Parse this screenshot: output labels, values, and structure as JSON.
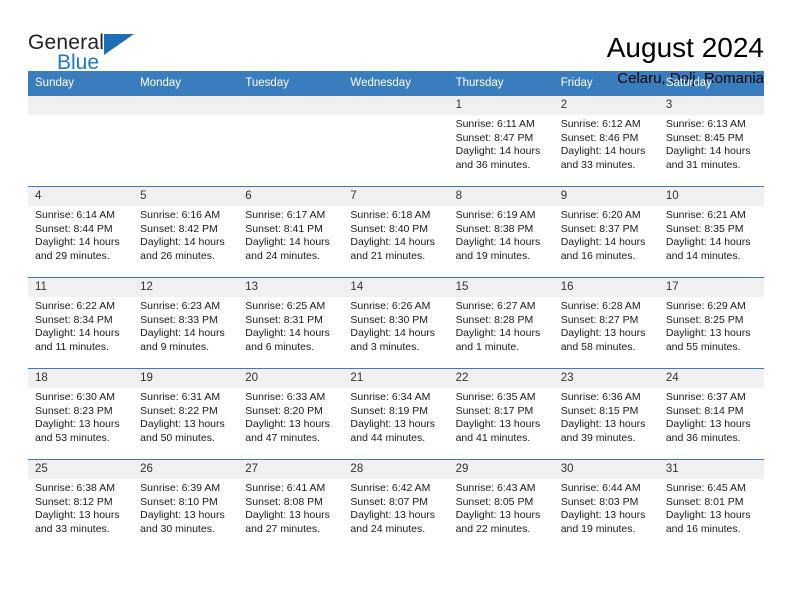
{
  "brand": {
    "name_top": "General",
    "name_bottom": "Blue",
    "accent_color": "#1f6fb5",
    "triangle_icon": "brand-triangle-icon"
  },
  "header": {
    "title": "August 2024",
    "subtitle": "Celaru, Dolj, Romania"
  },
  "calendar": {
    "header_bg": "#3a7dbf",
    "daynum_bg": "#f0f0f0",
    "weekday_headers": [
      "Sunday",
      "Monday",
      "Tuesday",
      "Wednesday",
      "Thursday",
      "Friday",
      "Saturday"
    ],
    "labels": {
      "sunrise": "Sunrise:",
      "sunset": "Sunset:",
      "daylight": "Daylight:"
    },
    "weeks": [
      [
        {
          "day": "",
          "blank": true
        },
        {
          "day": "",
          "blank": true
        },
        {
          "day": "",
          "blank": true
        },
        {
          "day": "",
          "blank": true
        },
        {
          "day": "1",
          "sunrise": "Sunrise: 6:11 AM",
          "sunset": "Sunset: 8:47 PM",
          "daylight_line1": "Daylight: 14 hours",
          "daylight_line2": "and 36 minutes."
        },
        {
          "day": "2",
          "sunrise": "Sunrise: 6:12 AM",
          "sunset": "Sunset: 8:46 PM",
          "daylight_line1": "Daylight: 14 hours",
          "daylight_line2": "and 33 minutes."
        },
        {
          "day": "3",
          "sunrise": "Sunrise: 6:13 AM",
          "sunset": "Sunset: 8:45 PM",
          "daylight_line1": "Daylight: 14 hours",
          "daylight_line2": "and 31 minutes."
        }
      ],
      [
        {
          "day": "4",
          "sunrise": "Sunrise: 6:14 AM",
          "sunset": "Sunset: 8:44 PM",
          "daylight_line1": "Daylight: 14 hours",
          "daylight_line2": "and 29 minutes."
        },
        {
          "day": "5",
          "sunrise": "Sunrise: 6:16 AM",
          "sunset": "Sunset: 8:42 PM",
          "daylight_line1": "Daylight: 14 hours",
          "daylight_line2": "and 26 minutes."
        },
        {
          "day": "6",
          "sunrise": "Sunrise: 6:17 AM",
          "sunset": "Sunset: 8:41 PM",
          "daylight_line1": "Daylight: 14 hours",
          "daylight_line2": "and 24 minutes."
        },
        {
          "day": "7",
          "sunrise": "Sunrise: 6:18 AM",
          "sunset": "Sunset: 8:40 PM",
          "daylight_line1": "Daylight: 14 hours",
          "daylight_line2": "and 21 minutes."
        },
        {
          "day": "8",
          "sunrise": "Sunrise: 6:19 AM",
          "sunset": "Sunset: 8:38 PM",
          "daylight_line1": "Daylight: 14 hours",
          "daylight_line2": "and 19 minutes."
        },
        {
          "day": "9",
          "sunrise": "Sunrise: 6:20 AM",
          "sunset": "Sunset: 8:37 PM",
          "daylight_line1": "Daylight: 14 hours",
          "daylight_line2": "and 16 minutes."
        },
        {
          "day": "10",
          "sunrise": "Sunrise: 6:21 AM",
          "sunset": "Sunset: 8:35 PM",
          "daylight_line1": "Daylight: 14 hours",
          "daylight_line2": "and 14 minutes."
        }
      ],
      [
        {
          "day": "11",
          "sunrise": "Sunrise: 6:22 AM",
          "sunset": "Sunset: 8:34 PM",
          "daylight_line1": "Daylight: 14 hours",
          "daylight_line2": "and 11 minutes."
        },
        {
          "day": "12",
          "sunrise": "Sunrise: 6:23 AM",
          "sunset": "Sunset: 8:33 PM",
          "daylight_line1": "Daylight: 14 hours",
          "daylight_line2": "and 9 minutes."
        },
        {
          "day": "13",
          "sunrise": "Sunrise: 6:25 AM",
          "sunset": "Sunset: 8:31 PM",
          "daylight_line1": "Daylight: 14 hours",
          "daylight_line2": "and 6 minutes."
        },
        {
          "day": "14",
          "sunrise": "Sunrise: 6:26 AM",
          "sunset": "Sunset: 8:30 PM",
          "daylight_line1": "Daylight: 14 hours",
          "daylight_line2": "and 3 minutes."
        },
        {
          "day": "15",
          "sunrise": "Sunrise: 6:27 AM",
          "sunset": "Sunset: 8:28 PM",
          "daylight_line1": "Daylight: 14 hours",
          "daylight_line2": "and 1 minute."
        },
        {
          "day": "16",
          "sunrise": "Sunrise: 6:28 AM",
          "sunset": "Sunset: 8:27 PM",
          "daylight_line1": "Daylight: 13 hours",
          "daylight_line2": "and 58 minutes."
        },
        {
          "day": "17",
          "sunrise": "Sunrise: 6:29 AM",
          "sunset": "Sunset: 8:25 PM",
          "daylight_line1": "Daylight: 13 hours",
          "daylight_line2": "and 55 minutes."
        }
      ],
      [
        {
          "day": "18",
          "sunrise": "Sunrise: 6:30 AM",
          "sunset": "Sunset: 8:23 PM",
          "daylight_line1": "Daylight: 13 hours",
          "daylight_line2": "and 53 minutes."
        },
        {
          "day": "19",
          "sunrise": "Sunrise: 6:31 AM",
          "sunset": "Sunset: 8:22 PM",
          "daylight_line1": "Daylight: 13 hours",
          "daylight_line2": "and 50 minutes."
        },
        {
          "day": "20",
          "sunrise": "Sunrise: 6:33 AM",
          "sunset": "Sunset: 8:20 PM",
          "daylight_line1": "Daylight: 13 hours",
          "daylight_line2": "and 47 minutes."
        },
        {
          "day": "21",
          "sunrise": "Sunrise: 6:34 AM",
          "sunset": "Sunset: 8:19 PM",
          "daylight_line1": "Daylight: 13 hours",
          "daylight_line2": "and 44 minutes."
        },
        {
          "day": "22",
          "sunrise": "Sunrise: 6:35 AM",
          "sunset": "Sunset: 8:17 PM",
          "daylight_line1": "Daylight: 13 hours",
          "daylight_line2": "and 41 minutes."
        },
        {
          "day": "23",
          "sunrise": "Sunrise: 6:36 AM",
          "sunset": "Sunset: 8:15 PM",
          "daylight_line1": "Daylight: 13 hours",
          "daylight_line2": "and 39 minutes."
        },
        {
          "day": "24",
          "sunrise": "Sunrise: 6:37 AM",
          "sunset": "Sunset: 8:14 PM",
          "daylight_line1": "Daylight: 13 hours",
          "daylight_line2": "and 36 minutes."
        }
      ],
      [
        {
          "day": "25",
          "sunrise": "Sunrise: 6:38 AM",
          "sunset": "Sunset: 8:12 PM",
          "daylight_line1": "Daylight: 13 hours",
          "daylight_line2": "and 33 minutes."
        },
        {
          "day": "26",
          "sunrise": "Sunrise: 6:39 AM",
          "sunset": "Sunset: 8:10 PM",
          "daylight_line1": "Daylight: 13 hours",
          "daylight_line2": "and 30 minutes."
        },
        {
          "day": "27",
          "sunrise": "Sunrise: 6:41 AM",
          "sunset": "Sunset: 8:08 PM",
          "daylight_line1": "Daylight: 13 hours",
          "daylight_line2": "and 27 minutes."
        },
        {
          "day": "28",
          "sunrise": "Sunrise: 6:42 AM",
          "sunset": "Sunset: 8:07 PM",
          "daylight_line1": "Daylight: 13 hours",
          "daylight_line2": "and 24 minutes."
        },
        {
          "day": "29",
          "sunrise": "Sunrise: 6:43 AM",
          "sunset": "Sunset: 8:05 PM",
          "daylight_line1": "Daylight: 13 hours",
          "daylight_line2": "and 22 minutes."
        },
        {
          "day": "30",
          "sunrise": "Sunrise: 6:44 AM",
          "sunset": "Sunset: 8:03 PM",
          "daylight_line1": "Daylight: 13 hours",
          "daylight_line2": "and 19 minutes."
        },
        {
          "day": "31",
          "sunrise": "Sunrise: 6:45 AM",
          "sunset": "Sunset: 8:01 PM",
          "daylight_line1": "Daylight: 13 hours",
          "daylight_line2": "and 16 minutes."
        }
      ]
    ]
  }
}
